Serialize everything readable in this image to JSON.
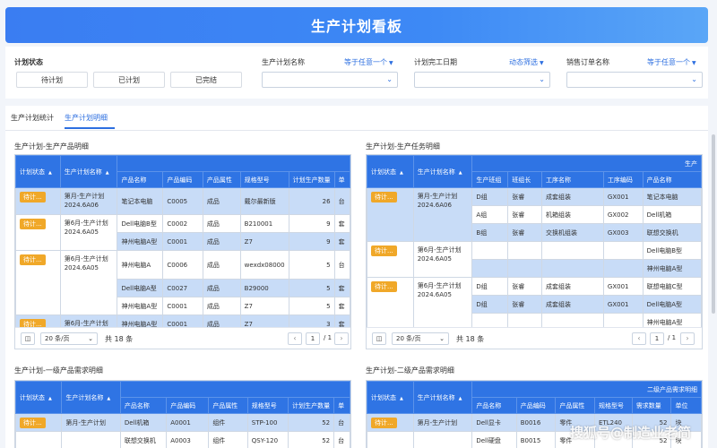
{
  "header": {
    "title": "生产计划看板"
  },
  "filters": {
    "plan_status_label": "计划状态",
    "status_buttons": [
      "待计划",
      "已计划",
      "已完结"
    ],
    "product_name_label": "生产计划名称",
    "product_name_op": "等于任意一个",
    "finish_date_label": "计划完工日期",
    "finish_date_op": "动态筛选",
    "sales_order_label": "销售订单名称",
    "sales_order_op": "等于任意一个"
  },
  "tabs": [
    {
      "label": "生产计划统计",
      "active": false
    },
    {
      "label": "生产计划明细",
      "active": true
    }
  ],
  "sections": {
    "s1": "生产计划-生产产品明细",
    "s2": "生产计划-生产任务明细",
    "s3": "生产计划-一级产品需求明细",
    "s4": "生产计划-二级产品需求明细"
  },
  "table1": {
    "headers": [
      "计划状态",
      "生产计划名称",
      "产品名称",
      "产品编码",
      "产品属性",
      "规格型号",
      "计划生产数量",
      "单"
    ],
    "groups": [
      {
        "status": "待计...",
        "plan": "第月-生产计划2024.6A06",
        "rows": [
          [
            "笔记本电脑",
            "C0005",
            "成品",
            "戴尔最新版",
            "26",
            "台"
          ]
        ]
      },
      {
        "status": "待计...",
        "plan": "第6月-生产计划2024.6A05",
        "rows": [
          [
            "Dell电脑B型",
            "C0002",
            "成品",
            "B210001",
            "9",
            "套"
          ],
          [
            "神州电脑A型",
            "C0001",
            "成品",
            "Z7",
            "9",
            "套"
          ]
        ]
      },
      {
        "status": "待计...",
        "plan": "第6月-生产计划2024.6A05",
        "rows": [
          [
            "神州电脑A",
            "C0006",
            "成品",
            "wexdx08000",
            "5",
            "台"
          ],
          [
            "Dell电脑A型",
            "C0027",
            "成品",
            "B29000",
            "5",
            "套"
          ],
          [
            "神州电脑A型",
            "C0001",
            "成品",
            "Z7",
            "5",
            "套"
          ]
        ]
      },
      {
        "status": "待计...",
        "plan": "第6月-生产计划",
        "rows": [
          [
            "神州电脑A型",
            "C0001",
            "成品",
            "Z7",
            "3",
            "套"
          ]
        ]
      }
    ],
    "page_size": "20 条/页",
    "total": "共 18 条",
    "page": "1",
    "pages": "/ 1"
  },
  "table2": {
    "headers": [
      "计划状态",
      "生产计划名称",
      "生产班组",
      "班组长",
      "工序名称",
      "工序编码",
      "产品名称"
    ],
    "super_header": "生产",
    "groups": [
      {
        "status": "待计...",
        "plan": "第月-生产计划2024.6A06",
        "rows": [
          [
            "D组",
            "张睿",
            "成套组装",
            "GX001",
            "笔记本电脑"
          ],
          [
            "A组",
            "张睿",
            "机箱组装",
            "GX002",
            "Dell机箱"
          ],
          [
            "B组",
            "张睿",
            "交换机组装",
            "GX003",
            "联想交换机"
          ]
        ]
      },
      {
        "status": "待计...",
        "plan": "第6月-生产计划2024.6A05",
        "rows": [
          [
            "",
            "",
            "",
            "",
            "Dell电脑B型"
          ],
          [
            "",
            "",
            "",
            "",
            "神州电脑A型"
          ]
        ]
      },
      {
        "status": "待计...",
        "plan": "第6月-生产计划2024.6A05",
        "rows": [
          [
            "D组",
            "张睿",
            "成套组装",
            "GX001",
            "联想电脑C型"
          ],
          [
            "D组",
            "张睿",
            "成套组装",
            "GX001",
            "Dell电脑A型"
          ],
          [
            "",
            "",
            "",
            "",
            "神州电脑A型"
          ]
        ]
      }
    ],
    "page_size": "20 条/页",
    "total": "共 18 条",
    "page": "1",
    "pages": "/ 1"
  },
  "table3": {
    "headers": [
      "计划状态",
      "生产计划名称",
      "产品名称",
      "产品编码",
      "产品属性",
      "规格型号",
      "计划生产数量",
      "单"
    ],
    "rows": [
      {
        "status": "待计...",
        "plan": "第月-生产计划",
        "cells": [
          "Dell机箱",
          "A0001",
          "组件",
          "STP-100",
          "52",
          "台"
        ]
      },
      {
        "status": "",
        "plan": "",
        "cells": [
          "联想交换机",
          "A0003",
          "组件",
          "QSY-120",
          "52",
          "台"
        ]
      }
    ]
  },
  "table4": {
    "headers": [
      "计划状态",
      "生产计划名称",
      "产品名称",
      "产品编码",
      "产品属性",
      "规格型号",
      "需求数量",
      "单位"
    ],
    "super_header": "二级产品需求明细",
    "rows": [
      {
        "status": "待计...",
        "plan": "第月-生产计划",
        "cells": [
          "Dell显卡",
          "B0016",
          "零件",
          "ETL240",
          "52",
          "块"
        ]
      },
      {
        "status": "",
        "plan": "",
        "cells": [
          "Dell硬盘",
          "B0015",
          "零件",
          "",
          "52",
          "块"
        ]
      }
    ]
  },
  "watermark": "搜狐号@制造业老简"
}
